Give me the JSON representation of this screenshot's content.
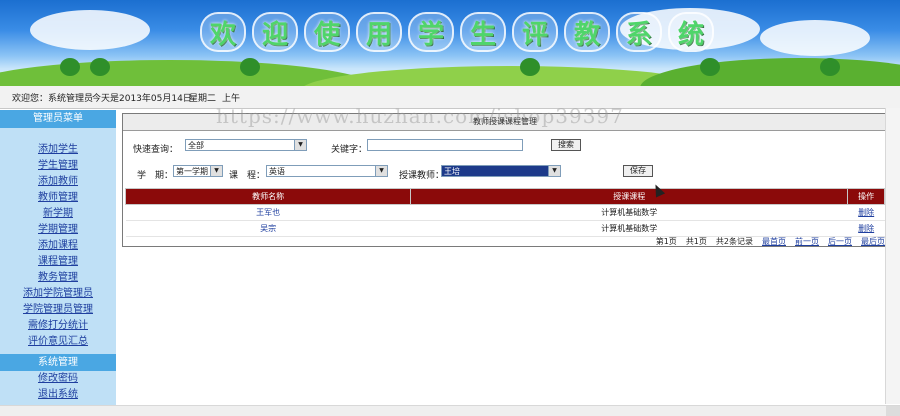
{
  "banner": {
    "title_chars": [
      "欢",
      "迎",
      "使",
      "用",
      "学",
      "生",
      "评",
      "教",
      "系",
      "统"
    ]
  },
  "welcome": {
    "user_text": "欢迎您：系统管理员",
    "date_text": "今天是2013年05月14日",
    "weekday_text": "星期二",
    "ampm_text": "上午"
  },
  "sidebar": {
    "header": "管理员菜单",
    "items": [
      {
        "label": "添加学生"
      },
      {
        "label": "学生管理"
      },
      {
        "label": "添加教师"
      },
      {
        "label": "教师管理"
      },
      {
        "label": "新学期"
      },
      {
        "label": "学期管理"
      },
      {
        "label": "添加课程"
      },
      {
        "label": "课程管理"
      },
      {
        "label": "教务管理"
      },
      {
        "label": "添加学院管理员"
      },
      {
        "label": "学院管理员管理"
      },
      {
        "label": "需修打分统计"
      },
      {
        "label": "评价意见汇总"
      }
    ],
    "section2_header": "系统管理",
    "section2_items": [
      {
        "label": "修改密码"
      },
      {
        "label": "退出系统"
      }
    ]
  },
  "panel": {
    "title": "教师授课课程管理",
    "quick_query_label": "快速查询：",
    "quick_query_value": "全部",
    "keyword_label": "关键字：",
    "keyword_value": "",
    "search_button": "搜索",
    "term_label": "学　期：",
    "term_value": "第一学期",
    "course_label": "课　程：",
    "course_value": "英语",
    "teacher_label": "授课教师：",
    "teacher_value": "王培",
    "save_button": "保存"
  },
  "table": {
    "headers": [
      "教师名称",
      "授课课程",
      "操作"
    ],
    "rows": [
      {
        "name": "王军也",
        "course": "计算机基础数学",
        "op": "删除"
      },
      {
        "name": "吴宗",
        "course": "计算机基础数学",
        "op": "删除"
      }
    ]
  },
  "pager": {
    "page_info": "第1页",
    "total_pages": "共1页",
    "total_records": "共2条记录",
    "first": "最首页",
    "prev": "前一页",
    "next": "后一页",
    "last": "最后页"
  },
  "watermark": "https://www.huzhan.com/ishop39397",
  "colors": {
    "table_header": "#8b0a0a",
    "sidebar_bg": "#bfe0f6",
    "sidebar_header": "#4aa7e3",
    "link": "#1f3f9f"
  }
}
